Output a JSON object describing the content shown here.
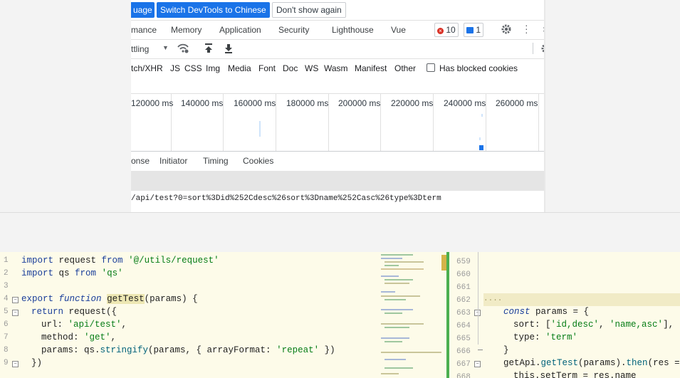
{
  "banner": {
    "language_button": "uage",
    "switch_button": "Switch DevTools to Chinese",
    "dont_show_button": "Don't show again"
  },
  "panel_tabs": [
    "mance",
    "Memory",
    "Application",
    "Security",
    "Lighthouse",
    "Vue"
  ],
  "badges": {
    "errors": "10",
    "messages": "1"
  },
  "toolbar": {
    "throttling": "ttling"
  },
  "filters": {
    "types": [
      "tch/XHR",
      "JS",
      "CSS",
      "Img",
      "Media",
      "Font",
      "Doc",
      "WS",
      "Wasm",
      "Manifest",
      "Other"
    ],
    "blocked_cookies": "Has blocked cookies"
  },
  "timeline": {
    "ticks": [
      "120000 ms",
      "140000 ms",
      "160000 ms",
      "180000 ms",
      "200000 ms",
      "220000 ms",
      "240000 ms",
      "260000 ms"
    ]
  },
  "detail_tabs": [
    "onse",
    "Initiator",
    "Timing",
    "Cookies"
  ],
  "request_url": "/api/test?0=sort%3Did%252Cdesc%26sort%3Dname%252Casc%26type%3Dterm",
  "editor_left": {
    "line_numbers": [
      "1",
      "2",
      "3",
      "4",
      "5",
      "6",
      "7",
      "8",
      "9"
    ],
    "lines": {
      "l1_kw": "import",
      "l1_rest": " request ",
      "l1_from": "from",
      "l1_str": "'@/utils/request'",
      "l2_kw": "import",
      "l2_rest": " qs ",
      "l2_from": "from",
      "l2_str": "'qs'",
      "l4_kw": "export",
      "l4_fn": "function",
      "l4_name": "getTest",
      "l4_rest": "(params) {",
      "l5_kw": "return",
      "l5_rest": " request({",
      "l6_key": "url: ",
      "l6_str": "'api/test'",
      "l6_end": ",",
      "l7_key": "method: ",
      "l7_str": "'get'",
      "l7_end": ",",
      "l8_key": "params: qs.",
      "l8_fn": "stringify",
      "l8_mid": "(params, { arrayFormat: ",
      "l8_str": "'repeat'",
      "l8_end": " })",
      "l9": "})"
    }
  },
  "editor_right": {
    "line_numbers": [
      "659",
      "660",
      "661",
      "662",
      "663",
      "664",
      "665",
      "666",
      "667",
      "668"
    ],
    "ellipsis": "....",
    "l663_kw": "const",
    "l663_rest": " params = {",
    "l664_key": "sort: [",
    "l664_s1": "'id,desc'",
    "l664_sep": ", ",
    "l664_s2": "'name,asc'",
    "l664_end": "],",
    "l665_key": "type: ",
    "l665_str": "'term'",
    "l666": "}",
    "l667_a": "getApi.",
    "l667_fn": "getTest",
    "l667_b": "(params).",
    "l667_then": "then",
    "l667_c": "(res =>",
    "l668": "this.setTerm = res.name"
  },
  "colors": {
    "accent": "#1a73e8",
    "error": "#d93025",
    "editor_bg": "#fdfbe9",
    "string": "#067d17",
    "keyword": "#1a3e9a"
  }
}
